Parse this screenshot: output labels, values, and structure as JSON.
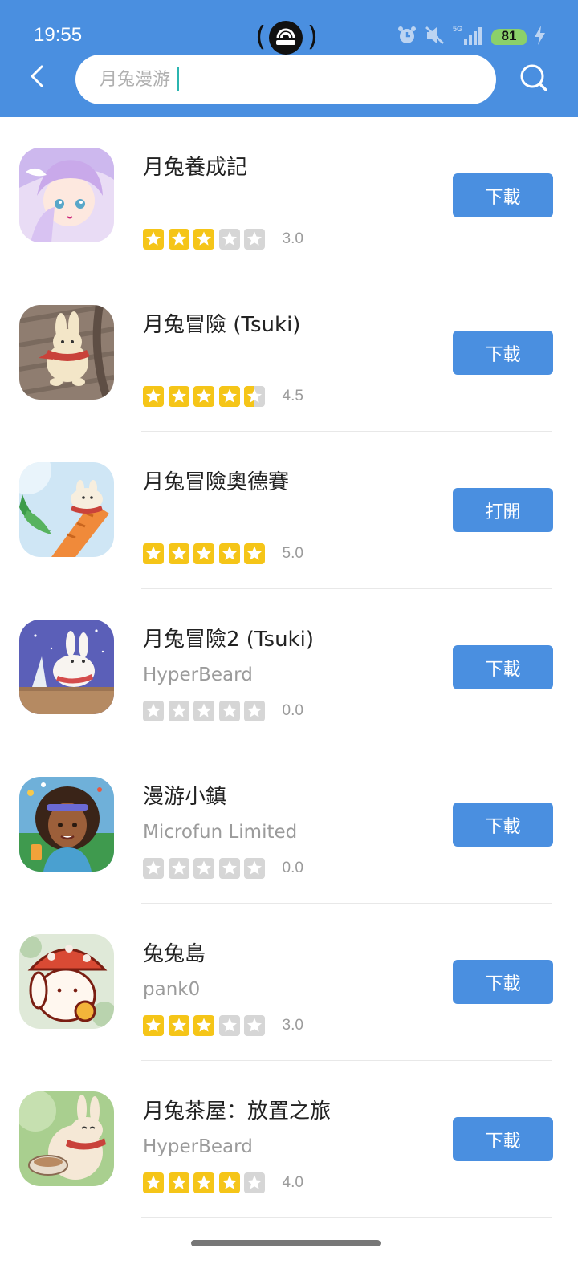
{
  "status_bar": {
    "time": "19:55",
    "battery": "81",
    "network": "5G"
  },
  "search": {
    "value": "",
    "placeholder": "月兔漫游"
  },
  "colors": {
    "header": "#4a8fe0",
    "button": "#4a8fe0",
    "star_on": "#f5c518",
    "star_off": "#d6d6d6"
  },
  "apps": [
    {
      "name": "月兔養成記",
      "developer": "",
      "rating": 3.0,
      "rating_text": "3.0",
      "action": "下載"
    },
    {
      "name": "月兔冒險 (Tsuki)",
      "developer": "",
      "rating": 4.5,
      "rating_text": "4.5",
      "action": "下載"
    },
    {
      "name": "月兔冒險奧德賽",
      "developer": "",
      "rating": 5.0,
      "rating_text": "5.0",
      "action": "打開"
    },
    {
      "name": "月兔冒險2 (Tsuki)",
      "developer": "HyperBeard",
      "rating": 0.0,
      "rating_text": "0.0",
      "action": "下載"
    },
    {
      "name": "漫游小鎮",
      "developer": "Microfun Limited",
      "rating": 0.0,
      "rating_text": "0.0",
      "action": "下載"
    },
    {
      "name": "兔兔島",
      "developer": "pank0",
      "rating": 3.0,
      "rating_text": "3.0",
      "action": "下載"
    },
    {
      "name": "月兔茶屋：放置之旅",
      "developer": "HyperBeard",
      "rating": 4.0,
      "rating_text": "4.0",
      "action": "下載"
    }
  ]
}
